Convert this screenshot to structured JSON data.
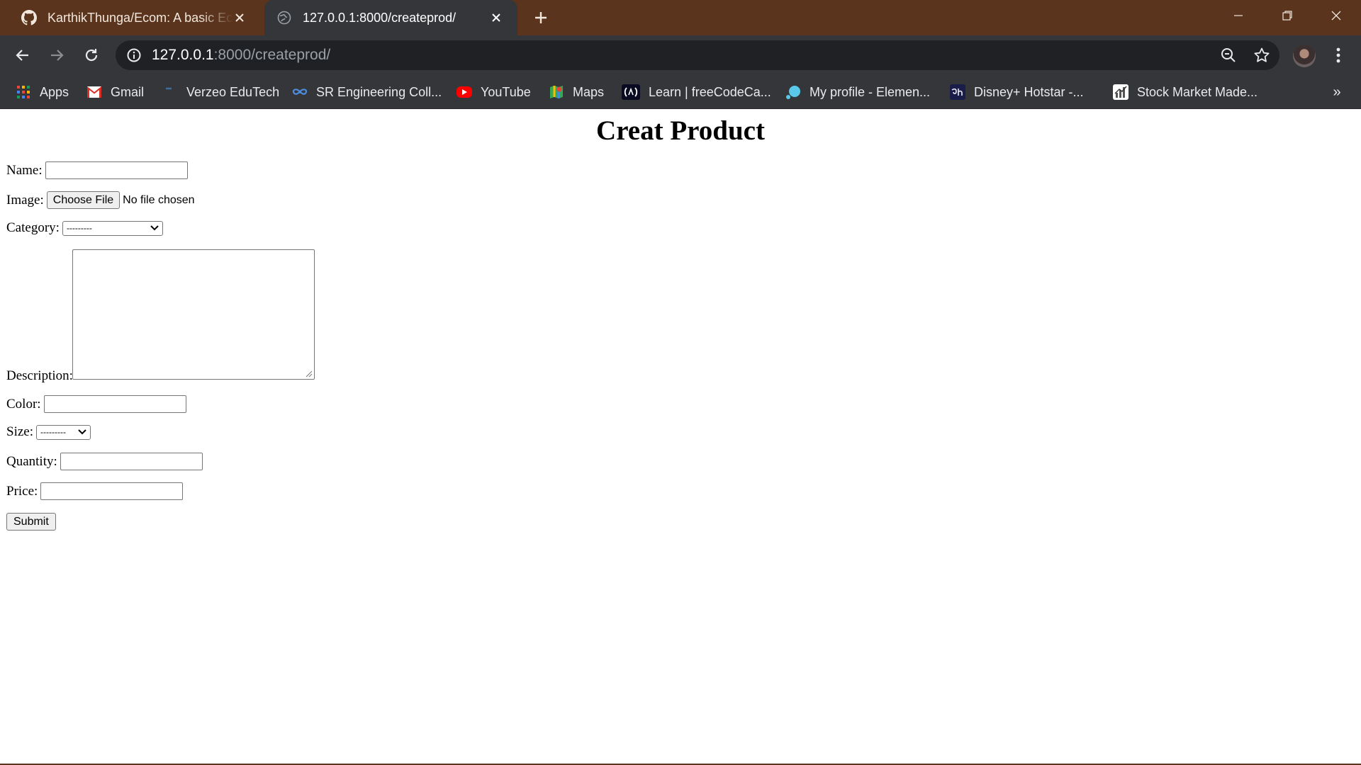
{
  "browser": {
    "tabs": [
      {
        "title": "KarthikThunga/Ecom: A basic Ecom",
        "favicon": "github-icon",
        "active": false
      },
      {
        "title": "127.0.0.1:8000/createprod/",
        "favicon": "globe-icon",
        "active": true
      }
    ],
    "url_host": "127.0.0.1",
    "url_rest": ":8000/createprod/",
    "bookmarks": [
      {
        "label": "Apps",
        "icon": "apps-grid-icon"
      },
      {
        "label": "Gmail",
        "icon": "gmail-icon"
      },
      {
        "label": "Verzeo EduTech",
        "icon": "verzeo-icon"
      },
      {
        "label": "SR Engineering Coll...",
        "icon": "sr-engineering-icon"
      },
      {
        "label": "YouTube",
        "icon": "youtube-icon"
      },
      {
        "label": "Maps",
        "icon": "maps-icon"
      },
      {
        "label": "Learn | freeCodeCa...",
        "icon": "freecodecamp-icon"
      },
      {
        "label": "My profile - Elemen...",
        "icon": "element-icon"
      },
      {
        "label": "Disney+ Hotstar -...",
        "icon": "hotstar-icon"
      },
      {
        "label": "Stock Market Made...",
        "icon": "stock-chart-icon"
      }
    ],
    "bookmarks_more": "»"
  },
  "form": {
    "title": "Creat Product",
    "name_label": "Name:",
    "name_value": "",
    "image_label": "Image:",
    "file_button": "Choose File",
    "file_status": "No file chosen",
    "category_label": "Category:",
    "category_selected": "---------",
    "description_label": "Description:",
    "description_value": "",
    "color_label": "Color:",
    "color_value": "",
    "size_label": "Size:",
    "size_selected": "---------",
    "quantity_label": "Quantity:",
    "quantity_value": "",
    "price_label": "Price:",
    "price_value": "",
    "submit_label": "Submit"
  },
  "colors": {
    "tabstrip": "#5a341d",
    "toolbar": "#35363a",
    "omnibox": "#202124"
  }
}
